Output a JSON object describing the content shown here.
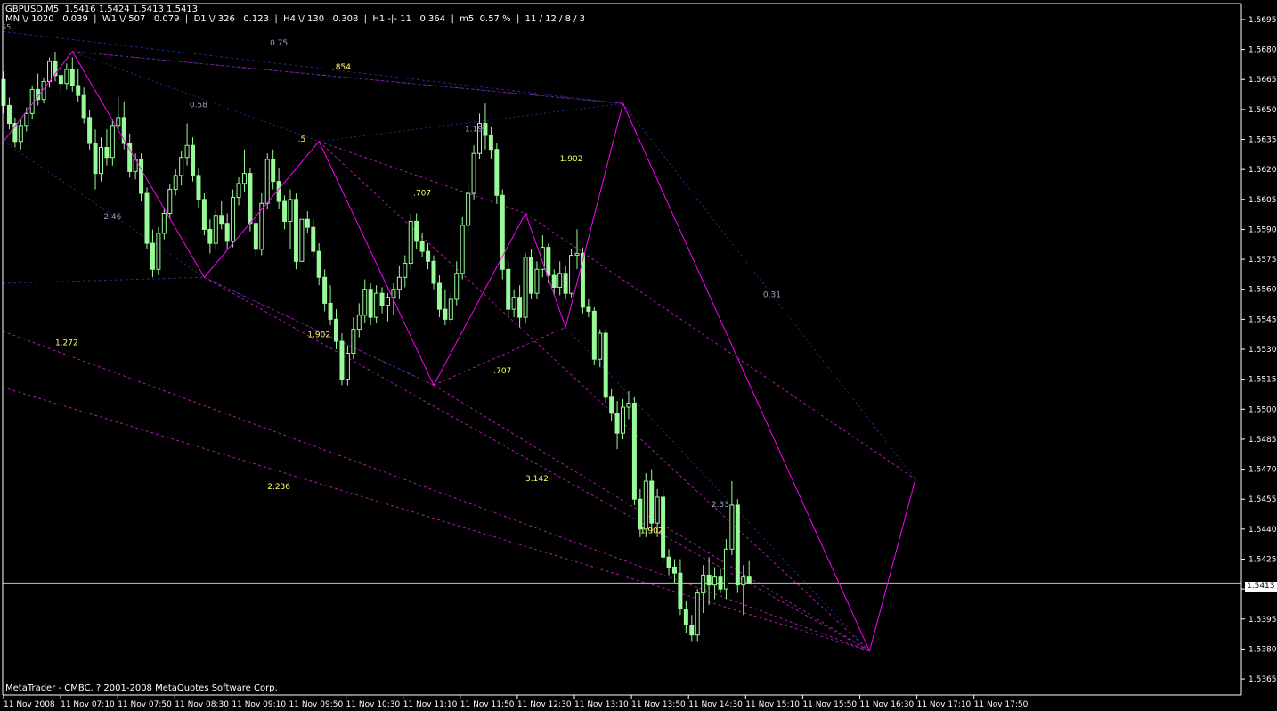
{
  "header": {
    "line1": "GBPUSD,M5  1.5416 1.5424 1.5413 1.5413",
    "line2": "MN \\/ 1020   0.039  |  W1 \\/ 507   0.079  |  D1 \\/ 326   0.123  |  H4 \\/ 130   0.308  |  H1 -|- 11   0.364  |  m5  0.57 %  |  11 / 12 / 8 / 3",
    "corner_label": "55"
  },
  "copyright": "MetaTrader - CMBC, ? 2001-2008 MetaQuotes Software Corp.",
  "current_price": "1.5413",
  "colors": {
    "background": "#000000",
    "candle": "#98fb98",
    "zigzag": "#ff00ff",
    "fib_dashed": "#b01ab0",
    "fib_blue": "#2a2a8a",
    "fib_label_yellow": "#ffff66",
    "fib_label_grey": "#9aa0c0",
    "axis": "#ffffff"
  },
  "chart_data": {
    "type": "candlestick",
    "symbol": "GBPUSD",
    "timeframe": "M5",
    "ylim": [
      1.5357,
      1.5703
    ],
    "y_ticks": [
      "1.5695",
      "1.5680",
      "1.5665",
      "1.5650",
      "1.5635",
      "1.5620",
      "1.5605",
      "1.5590",
      "1.5575",
      "1.5560",
      "1.5545",
      "1.5530",
      "1.5515",
      "1.5500",
      "1.5485",
      "1.5470",
      "1.5455",
      "1.5440",
      "1.5425",
      "1.5410",
      "1.5395",
      "1.5380",
      "1.5365"
    ],
    "x_ticks": [
      "11 Nov 2008",
      "11 Nov 07:10",
      "11 Nov 07:50",
      "11 Nov 08:30",
      "11 Nov 09:10",
      "11 Nov 09:50",
      "11 Nov 10:30",
      "11 Nov 11:10",
      "11 Nov 11:50",
      "11 Nov 12:30",
      "11 Nov 13:10",
      "11 Nov 13:50",
      "11 Nov 14:30",
      "11 Nov 15:10",
      "11 Nov 15:50",
      "11 Nov 16:30",
      "11 Nov 17:10",
      "11 Nov 17:50"
    ],
    "candles": [
      [
        1.5665,
        1.5669,
        1.5648,
        1.5652
      ],
      [
        1.5652,
        1.5656,
        1.564,
        1.5643
      ],
      [
        1.5643,
        1.5646,
        1.5631,
        1.5634
      ],
      [
        1.5634,
        1.5645,
        1.563,
        1.5642
      ],
      [
        1.5642,
        1.5651,
        1.5639,
        1.5648
      ],
      [
        1.5648,
        1.5662,
        1.5645,
        1.566
      ],
      [
        1.566,
        1.5668,
        1.5652,
        1.5655
      ],
      [
        1.5655,
        1.5666,
        1.5653,
        1.5664
      ],
      [
        1.5664,
        1.5676,
        1.5661,
        1.5674
      ],
      [
        1.5674,
        1.5679,
        1.5664,
        1.5667
      ],
      [
        1.5667,
        1.5671,
        1.5658,
        1.5663
      ],
      [
        1.5663,
        1.5673,
        1.566,
        1.567
      ],
      [
        1.567,
        1.5676,
        1.5659,
        1.5662
      ],
      [
        1.5662,
        1.567,
        1.5654,
        1.5657
      ],
      [
        1.5657,
        1.5661,
        1.5643,
        1.5646
      ],
      [
        1.5646,
        1.565,
        1.563,
        1.5633
      ],
      [
        1.5633,
        1.564,
        1.561,
        1.5618
      ],
      [
        1.5618,
        1.5636,
        1.5614,
        1.5631
      ],
      [
        1.5631,
        1.564,
        1.5622,
        1.5626
      ],
      [
        1.5626,
        1.5645,
        1.5622,
        1.5642
      ],
      [
        1.5642,
        1.5656,
        1.564,
        1.5646
      ],
      [
        1.5646,
        1.5654,
        1.563,
        1.5633
      ],
      [
        1.5633,
        1.5638,
        1.5616,
        1.5619
      ],
      [
        1.5619,
        1.5628,
        1.5615,
        1.5625
      ],
      [
        1.5625,
        1.5628,
        1.5604,
        1.5608
      ],
      [
        1.5608,
        1.5611,
        1.558,
        1.5583
      ],
      [
        1.5583,
        1.559,
        1.5566,
        1.557
      ],
      [
        1.557,
        1.5591,
        1.5567,
        1.5588
      ],
      [
        1.5588,
        1.5601,
        1.5585,
        1.5598
      ],
      [
        1.5598,
        1.5613,
        1.5595,
        1.561
      ],
      [
        1.561,
        1.562,
        1.5607,
        1.5617
      ],
      [
        1.5617,
        1.5629,
        1.5612,
        1.5626
      ],
      [
        1.5626,
        1.5643,
        1.5622,
        1.5632
      ],
      [
        1.5632,
        1.5636,
        1.5614,
        1.5617
      ],
      [
        1.5617,
        1.5621,
        1.5601,
        1.5605
      ],
      [
        1.5605,
        1.5608,
        1.5587,
        1.559
      ],
      [
        1.559,
        1.5595,
        1.5578,
        1.5583
      ],
      [
        1.5583,
        1.56,
        1.558,
        1.5597
      ],
      [
        1.5597,
        1.5604,
        1.559,
        1.5593
      ],
      [
        1.5593,
        1.5598,
        1.558,
        1.5584
      ],
      [
        1.5584,
        1.561,
        1.5581,
        1.5606
      ],
      [
        1.5606,
        1.5616,
        1.5602,
        1.5613
      ],
      [
        1.5613,
        1.563,
        1.5609,
        1.5618
      ],
      [
        1.5618,
        1.5621,
        1.5589,
        1.5593
      ],
      [
        1.5593,
        1.5599,
        1.5576,
        1.558
      ],
      [
        1.558,
        1.5608,
        1.5577,
        1.5603
      ],
      [
        1.5603,
        1.5628,
        1.56,
        1.5625
      ],
      [
        1.5625,
        1.563,
        1.561,
        1.5614
      ],
      [
        1.5614,
        1.5621,
        1.56,
        1.5604
      ],
      [
        1.5604,
        1.5607,
        1.559,
        1.5594
      ],
      [
        1.5594,
        1.561,
        1.558,
        1.5605
      ],
      [
        1.5605,
        1.5608,
        1.557,
        1.5574
      ],
      [
        1.5574,
        1.558,
        1.5583,
        1.5595
      ],
      [
        1.5595,
        1.5599,
        1.5588,
        1.5591
      ],
      [
        1.5591,
        1.5595,
        1.5576,
        1.5579
      ],
      [
        1.5579,
        1.5583,
        1.5562,
        1.5566
      ],
      [
        1.5566,
        1.557,
        1.5549,
        1.5553
      ],
      [
        1.5553,
        1.5562,
        1.5542,
        1.5545
      ],
      [
        1.5545,
        1.555,
        1.553,
        1.5534
      ],
      [
        1.5534,
        1.5538,
        1.5512,
        1.5515
      ],
      [
        1.5515,
        1.5532,
        1.5512,
        1.5528
      ],
      [
        1.5528,
        1.5546,
        1.5525,
        1.554
      ],
      [
        1.554,
        1.5553,
        1.5536,
        1.5547
      ],
      [
        1.5547,
        1.5565,
        1.5543,
        1.556
      ],
      [
        1.556,
        1.5563,
        1.5542,
        1.5546
      ],
      [
        1.5546,
        1.5562,
        1.5543,
        1.5558
      ],
      [
        1.5558,
        1.5561,
        1.5548,
        1.5552
      ],
      [
        1.5552,
        1.5558,
        1.5544,
        1.5556
      ],
      [
        1.5556,
        1.5563,
        1.5547,
        1.556
      ],
      [
        1.556,
        1.5572,
        1.5555,
        1.5566
      ],
      [
        1.5566,
        1.5577,
        1.5561,
        1.5573
      ],
      [
        1.5573,
        1.5598,
        1.557,
        1.5594
      ],
      [
        1.5594,
        1.5598,
        1.558,
        1.5584
      ],
      [
        1.5584,
        1.5588,
        1.5576,
        1.5579
      ],
      [
        1.5579,
        1.5583,
        1.557,
        1.5574
      ],
      [
        1.5574,
        1.5577,
        1.556,
        1.5563
      ],
      [
        1.5563,
        1.5567,
        1.5546,
        1.555
      ],
      [
        1.555,
        1.556,
        1.5542,
        1.5545
      ],
      [
        1.5545,
        1.5558,
        1.5543,
        1.5555
      ],
      [
        1.5555,
        1.5574,
        1.5552,
        1.5568
      ],
      [
        1.5568,
        1.5596,
        1.5565,
        1.5592
      ],
      [
        1.5592,
        1.5612,
        1.5589,
        1.5608
      ],
      [
        1.5608,
        1.5632,
        1.5605,
        1.5628
      ],
      [
        1.5628,
        1.5648,
        1.5625,
        1.5643
      ],
      [
        1.5643,
        1.5653,
        1.563,
        1.5637
      ],
      [
        1.5637,
        1.5641,
        1.5625,
        1.563
      ],
      [
        1.563,
        1.5633,
        1.5603,
        1.5607
      ],
      [
        1.5607,
        1.561,
        1.5565,
        1.557
      ],
      [
        1.557,
        1.5574,
        1.5546,
        1.555
      ],
      [
        1.555,
        1.556,
        1.5546,
        1.5556
      ],
      [
        1.5556,
        1.5562,
        1.5541,
        1.5546
      ],
      [
        1.5546,
        1.5578,
        1.5543,
        1.5576
      ],
      [
        1.5576,
        1.558,
        1.5555,
        1.5558
      ],
      [
        1.5558,
        1.5574,
        1.5555,
        1.557
      ],
      [
        1.557,
        1.5587,
        1.5566,
        1.5581
      ],
      [
        1.5581,
        1.5583,
        1.5563,
        1.5567
      ],
      [
        1.5567,
        1.557,
        1.5557,
        1.5561
      ],
      [
        1.5561,
        1.5574,
        1.5557,
        1.5568
      ],
      [
        1.5568,
        1.5572,
        1.5555,
        1.5558
      ],
      [
        1.5558,
        1.558,
        1.5556,
        1.5577
      ],
      [
        1.5577,
        1.559,
        1.557,
        1.5578
      ],
      [
        1.5578,
        1.5581,
        1.5548,
        1.5551
      ],
      [
        1.5551,
        1.5555,
        1.5546,
        1.5549
      ],
      [
        1.5549,
        1.5551,
        1.5522,
        1.5525
      ],
      [
        1.5525,
        1.554,
        1.5521,
        1.5538
      ],
      [
        1.5538,
        1.554,
        1.5503,
        1.5506
      ],
      [
        1.5506,
        1.551,
        1.5494,
        1.5498
      ],
      [
        1.5498,
        1.5504,
        1.548,
        1.5488
      ],
      [
        1.5488,
        1.5505,
        1.5485,
        1.5501
      ],
      [
        1.5501,
        1.5509,
        1.5495,
        1.5503
      ],
      [
        1.5503,
        1.5506,
        1.5452,
        1.5455
      ],
      [
        1.5455,
        1.546,
        1.5436,
        1.544
      ],
      [
        1.544,
        1.5468,
        1.5436,
        1.5464
      ],
      [
        1.5464,
        1.547,
        1.5438,
        1.5443
      ],
      [
        1.5443,
        1.546,
        1.5436,
        1.5456
      ],
      [
        1.5456,
        1.5461,
        1.5423,
        1.5426
      ],
      [
        1.5426,
        1.543,
        1.5417,
        1.5421
      ],
      [
        1.5421,
        1.5425,
        1.5413,
        1.5418
      ],
      [
        1.5418,
        1.5425,
        1.5397,
        1.54
      ],
      [
        1.54,
        1.5404,
        1.5388,
        1.5392
      ],
      [
        1.5392,
        1.5397,
        1.5384,
        1.5387
      ],
      [
        1.5387,
        1.541,
        1.5384,
        1.5408
      ],
      [
        1.5408,
        1.5422,
        1.5398,
        1.5417
      ],
      [
        1.5417,
        1.5426,
        1.5402,
        1.5412
      ],
      [
        1.5412,
        1.5421,
        1.5405,
        1.5416
      ],
      [
        1.5416,
        1.542,
        1.5408,
        1.541
      ],
      [
        1.541,
        1.5435,
        1.5405,
        1.543
      ],
      [
        1.543,
        1.5464,
        1.5427,
        1.5452
      ],
      [
        1.5452,
        1.5455,
        1.5408,
        1.5412
      ],
      [
        1.5412,
        1.5422,
        1.5397,
        1.5416
      ],
      [
        1.5416,
        1.5424,
        1.5413,
        1.5413
      ]
    ],
    "zigzag": [
      {
        "i": 0,
        "p": 1.5634
      },
      {
        "i": 12,
        "p": 1.5679
      },
      {
        "i": 35,
        "p": 1.5566
      },
      {
        "i": 55,
        "p": 1.5634
      },
      {
        "i": 75,
        "p": 1.5512
      },
      {
        "i": 91,
        "p": 1.5598
      },
      {
        "i": 98,
        "p": 1.5541
      },
      {
        "i": 108,
        "p": 1.5653
      },
      {
        "i": 151,
        "p": 1.5379
      },
      {
        "i": 159,
        "p": 1.5465
      }
    ],
    "fib_labels": [
      {
        "text": "0.75",
        "i": 48,
        "p": 1.5682,
        "c": "grey"
      },
      {
        "text": ".854",
        "i": 59,
        "p": 1.567,
        "c": "yellow"
      },
      {
        "text": "0.58",
        "i": 34,
        "p": 1.5651,
        "c": "grey"
      },
      {
        "text": "1.19",
        "i": 82,
        "p": 1.5639,
        "c": "grey"
      },
      {
        "text": ".5",
        "i": 52,
        "p": 1.5634,
        "c": "yellow"
      },
      {
        "text": "1.902",
        "i": 99,
        "p": 1.5624,
        "c": "yellow"
      },
      {
        "text": ".707",
        "i": 73,
        "p": 1.5607,
        "c": "yellow"
      },
      {
        "text": "2.46",
        "i": 19,
        "p": 1.5595,
        "c": "grey"
      },
      {
        "text": "0.31",
        "i": 134,
        "p": 1.5556,
        "c": "grey"
      },
      {
        "text": "1.902",
        "i": 55,
        "p": 1.5536,
        "c": "yellow"
      },
      {
        "text": "1.272",
        "i": 11,
        "p": 1.5532,
        "c": "yellow"
      },
      {
        "text": ".707",
        "i": 87,
        "p": 1.5518,
        "c": "yellow"
      },
      {
        "text": "3.142",
        "i": 93,
        "p": 1.5464,
        "c": "yellow"
      },
      {
        "text": "2.236",
        "i": 48,
        "p": 1.546,
        "c": "yellow"
      },
      {
        "text": "2.33",
        "i": 125,
        "p": 1.5451,
        "c": "grey"
      },
      {
        "text": "1.902",
        "i": 113,
        "p": 1.5438,
        "c": "yellow"
      }
    ]
  }
}
